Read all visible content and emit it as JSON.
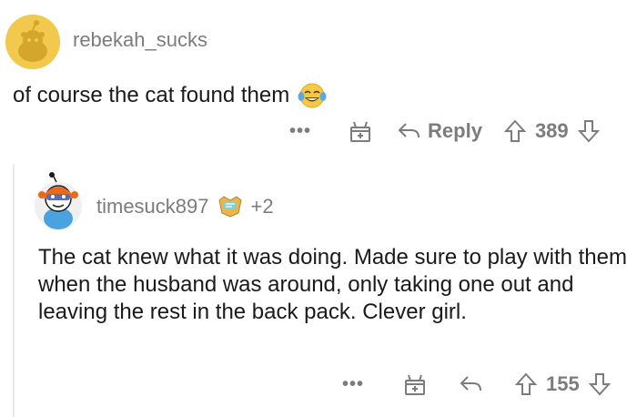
{
  "comment1": {
    "username": "rebekah_sucks",
    "text": "of course the cat found them",
    "emoji_icon": "joy-emoji-icon",
    "actions": {
      "more": "•••",
      "reply_label": "Reply",
      "score": "389"
    }
  },
  "comment2": {
    "username": "timesuck897",
    "award_count": "+2",
    "text": "The cat knew what it was doing. Made sure to play with them when the husband was around, only taking one out and leaving the rest in the back pack. Clever girl.",
    "actions": {
      "more": "•••",
      "score": "155"
    }
  },
  "colors": {
    "meta_gray": "#7c7c7c",
    "avatar1_bg": "#f2c94c",
    "thread_line": "#e8e8e8"
  }
}
